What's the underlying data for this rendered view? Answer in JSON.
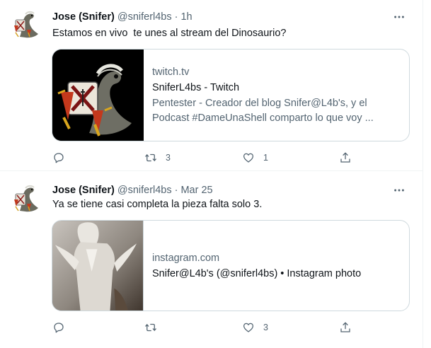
{
  "tweets": [
    {
      "author_name": "Jose (Snifer)",
      "author_handle": "@sniferl4bs",
      "separator": "·",
      "time": "1h",
      "text": "Estamos en vivo  te unes al stream del Dinosaurio?",
      "card": {
        "domain": "twitch.tv",
        "title": "SniferL4bs - Twitch",
        "description_line1": "Pentester - Creador del blog Snifer@L4b's, y el",
        "description_line2": "Podcast #DameUnaShell comparto lo que voy ..."
      },
      "retweets": "3",
      "likes": "1"
    },
    {
      "author_name": "Jose (Snifer)",
      "author_handle": "@sniferl4bs",
      "separator": "·",
      "time": "Mar 25",
      "text": "Ya se tiene casi completa la pieza falta solo 3.",
      "card": {
        "domain": "instagram.com",
        "title": "Snifer@L4b's (@sniferl4bs) • Instagram photo"
      },
      "retweets": "",
      "likes": "3"
    }
  ],
  "icons": {
    "avatar": "dinosaur-avatar",
    "more": "more-icon",
    "reply": "reply-icon",
    "retweet": "retweet-icon",
    "like": "like-icon",
    "share": "share-icon"
  },
  "colors": {
    "text_primary": "#0f1419",
    "text_secondary": "#536471",
    "border": "#cfd9de"
  }
}
